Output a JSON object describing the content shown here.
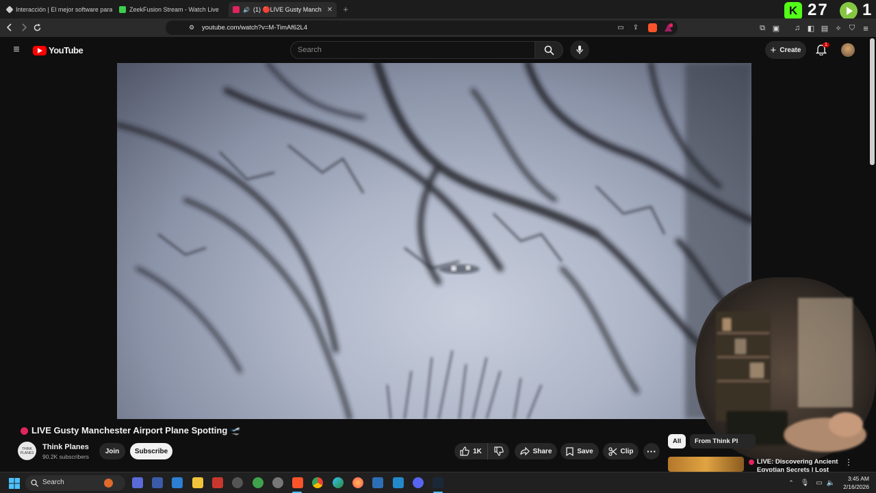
{
  "tabs": [
    {
      "title": "Interacción | El mejor software para p",
      "favicon_color": "#cfcfcf"
    },
    {
      "title": "ZeekFusion Stream - Watch Live",
      "favicon_color": "#3ccf4e"
    },
    {
      "title": "(1) 🔴LIVE Gusty Manchester",
      "favicon_color": "#e0245e"
    }
  ],
  "url": "youtube.com/watch?v=M-TimAf62L4",
  "overlay": {
    "kick_count": "27",
    "rumble_count": "1"
  },
  "youtube": {
    "logo_text": "YouTube",
    "search_placeholder": "Search",
    "create_label": "Create",
    "notification_count": "1"
  },
  "video": {
    "title": "LIVE Gusty Manchester Airport Plane Spotting 🛫",
    "channel_name": "Think Planes",
    "avatar_text": "THINK PLANES",
    "subscribers": "90.2K subscribers",
    "join_label": "Join",
    "subscribe_label": "Subscribe",
    "like_count": "1K",
    "share_label": "Share",
    "save_label": "Save",
    "clip_label": "Clip"
  },
  "chips": {
    "all": "All",
    "from_channel": "From Think Pl"
  },
  "recommendation": {
    "title": "LIVE: Discovering Ancient Egyptian Secrets | Lost"
  },
  "taskbar": {
    "search_label": "Search",
    "time": "3:45 AM",
    "date": "2/16/2026"
  }
}
